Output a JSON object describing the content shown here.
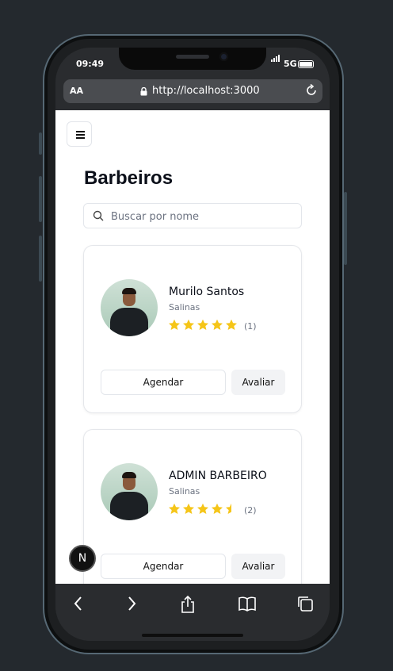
{
  "status": {
    "time": "09:49",
    "network": "5G"
  },
  "browser": {
    "text_size_label": "AA",
    "url": "http://localhost:3000"
  },
  "page": {
    "title": "Barbeiros",
    "search": {
      "placeholder": "Buscar por nome",
      "value": ""
    }
  },
  "barbers": [
    {
      "name": "Murilo Santos",
      "city": "Salinas",
      "rating": 5,
      "count": "(1)",
      "book_label": "Agendar",
      "rate_label": "Avaliar"
    },
    {
      "name": "ADMIN BARBEIRO",
      "city": "Salinas",
      "rating": 4.5,
      "count": "(2)",
      "book_label": "Agendar",
      "rate_label": "Avaliar"
    }
  ],
  "dev_badge": "N",
  "colors": {
    "star": "#f5c518",
    "page_bg": "#ffffff",
    "text": "#0b0f19",
    "muted": "#6b7280"
  },
  "icons": [
    "menu-icon",
    "search-icon",
    "star-icon",
    "lock-icon",
    "reload-icon",
    "back-icon",
    "forward-icon",
    "share-icon",
    "bookmarks-icon",
    "tabs-icon"
  ]
}
